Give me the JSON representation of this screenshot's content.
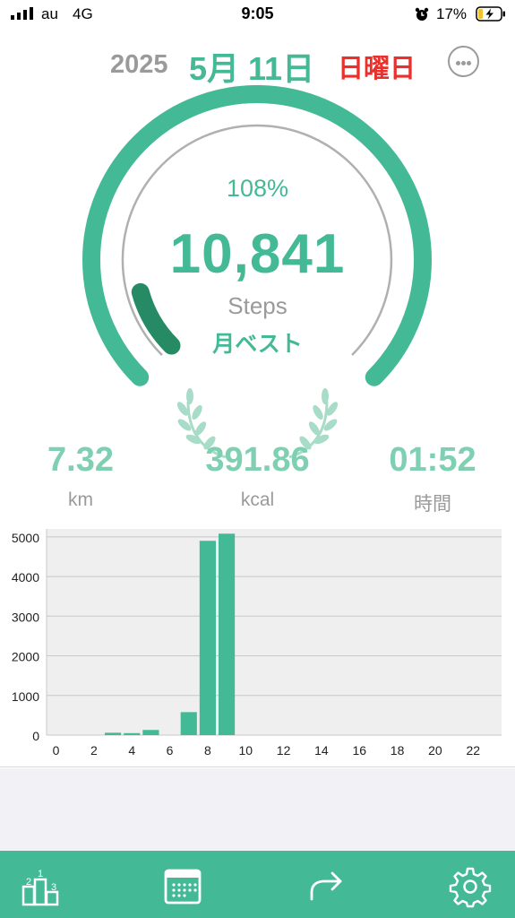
{
  "status_bar": {
    "carrier": "au",
    "network": "4G",
    "time": "9:05",
    "battery_percent": "17%"
  },
  "header": {
    "year": "2025",
    "month_day": "5月 11日",
    "weekday": "日曜日",
    "more_icon": "ellipsis-circle-icon"
  },
  "progress": {
    "percent_label": "108%",
    "ratio": 1.08,
    "steps": "10,841",
    "steps_label": "Steps",
    "badge": "月ベスト"
  },
  "stats": {
    "distance": "7.32",
    "distance_unit": "km",
    "calories": "391.86",
    "calories_unit": "kcal",
    "duration": "01:52",
    "duration_unit": "時間"
  },
  "chart_data": {
    "type": "bar",
    "xlabel": "",
    "ylabel": "",
    "ylim": [
      0,
      5200
    ],
    "y_ticks": [
      0,
      1000,
      2000,
      3000,
      4000,
      5000
    ],
    "x_ticks": [
      0,
      2,
      4,
      6,
      8,
      10,
      12,
      14,
      16,
      18,
      20,
      22
    ],
    "grid": true,
    "x": [
      0,
      1,
      2,
      3,
      4,
      5,
      6,
      7,
      8,
      9,
      10,
      11,
      12,
      13,
      14,
      15,
      16,
      17,
      18,
      19,
      20,
      21,
      22,
      23
    ],
    "values": [
      0,
      0,
      0,
      60,
      50,
      130,
      0,
      580,
      4900,
      5080,
      0,
      0,
      0,
      0,
      0,
      0,
      0,
      0,
      0,
      0,
      0,
      0,
      0,
      0
    ],
    "color": "#43b996"
  },
  "tab_bar": {
    "color": "#43b996",
    "items": [
      {
        "icon": "ranking-podium-icon"
      },
      {
        "icon": "calendar-icon"
      },
      {
        "icon": "share-arrow-icon"
      },
      {
        "icon": "gear-icon"
      }
    ]
  },
  "colors": {
    "accent": "#43b996",
    "accent_dark": "#268a65",
    "weekday_red": "#e8302c",
    "muted": "#9a9a9a"
  }
}
